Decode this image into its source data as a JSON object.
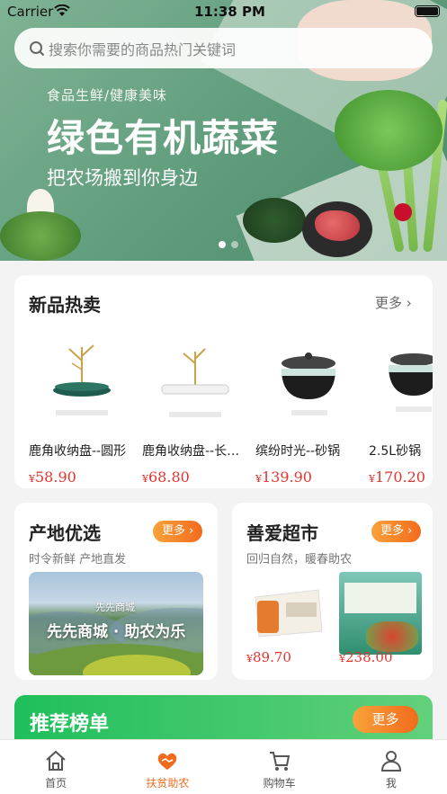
{
  "status_bar": {
    "carrier": "Carrier",
    "time": "11:38 PM"
  },
  "search": {
    "placeholder": "搜索你需要的商品热门关键词"
  },
  "banner": {
    "subtitle": "食品生鲜/健康美味",
    "title": "绿色有机蔬菜",
    "tagline": "把农场搬到你身边",
    "dots": 2,
    "active_dot": 1
  },
  "new_products": {
    "title": "新品热卖",
    "more": "更多 ›",
    "items": [
      {
        "name": "鹿角收纳盘--圆形",
        "price": "58.90",
        "currency": "¥"
      },
      {
        "name": "鹿角收纳盘--长方形",
        "price": "68.80",
        "currency": "¥"
      },
      {
        "name": "缤纷时光--砂锅",
        "price": "139.90",
        "currency": "¥"
      },
      {
        "name": "2.5L砂锅",
        "price": "170.20",
        "currency": "¥"
      }
    ]
  },
  "origin": {
    "title": "产地优选",
    "more": "更多 ›",
    "subtitle": "时令新鲜 产地直发",
    "photo_brand": "先先商城",
    "photo_text": "先先商城 · 助农为乐"
  },
  "charity_market": {
    "title": "善爱超市",
    "more": "更多 ›",
    "subtitle": "回归自然，暖春助农",
    "items": [
      {
        "price": "89.70",
        "currency": "¥"
      },
      {
        "price": "238.00",
        "currency": "¥"
      }
    ]
  },
  "recommend": {
    "title": "推荐榜单",
    "more": "更多"
  },
  "tabs": [
    {
      "label": "首页",
      "icon": "home-icon"
    },
    {
      "label": "扶贫助农",
      "icon": "charity-icon"
    },
    {
      "label": "购物车",
      "icon": "cart-icon"
    },
    {
      "label": "我",
      "icon": "profile-icon"
    }
  ],
  "colors": {
    "accent": "#f26b1d",
    "price": "#e3342f",
    "green": "#1fbf5c"
  }
}
